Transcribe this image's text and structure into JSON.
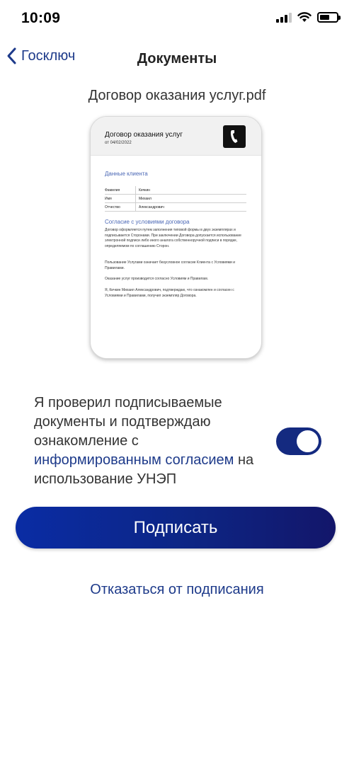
{
  "status_bar": {
    "time": "10:09",
    "icons": [
      "signal-icon",
      "wifi-icon",
      "battery-icon"
    ]
  },
  "nav": {
    "back_label": "Госключ",
    "title": "Документы"
  },
  "document": {
    "file_name": "Договор оказания услуг.pdf",
    "preview": {
      "title": "Договор оказания услуг",
      "date": "от 04/02/2022",
      "client_section": "Данные клиента",
      "client_rows": [
        {
          "key": "Фамилия",
          "value": "Кичкин"
        },
        {
          "key": "Имя",
          "value": "Михаил"
        },
        {
          "key": "Отчество",
          "value": "Александрович"
        }
      ],
      "terms_section": "Согласие с условиями договора",
      "paragraph_1": "Договор оформляется путем заполнения типовой формы в двух экземплярах и подписывается Сторонами. При заключении Договора допускается использование электронной подписи либо иного аналога собственноручной подписи в порядке, определяемом по соглашению Сторон.",
      "paragraph_2": "Пользование Услугами означает безусловное согласие Клиента с Условиями и Правилами.",
      "paragraph_3": "Оказание услуг производится согласно Условиям и Правилам.",
      "paragraph_4": "Я, Кичкин Михаил Александрович, подтверждаю, что ознакомлен и согласен с Условиями и Правилами, получил экземпляр Договора."
    }
  },
  "consent": {
    "text_before": "Я проверил подписываемые документы и подтверждаю ознакомление с ",
    "link_text": "информированным согласием",
    "text_after": " на использование УНЭП",
    "toggle_on": true
  },
  "actions": {
    "sign_label": "Подписать",
    "decline_label": "Отказаться от подписания"
  },
  "colors": {
    "accent": "#1d3a8a",
    "button_start": "#0a2ca4",
    "button_end": "#13166a"
  }
}
